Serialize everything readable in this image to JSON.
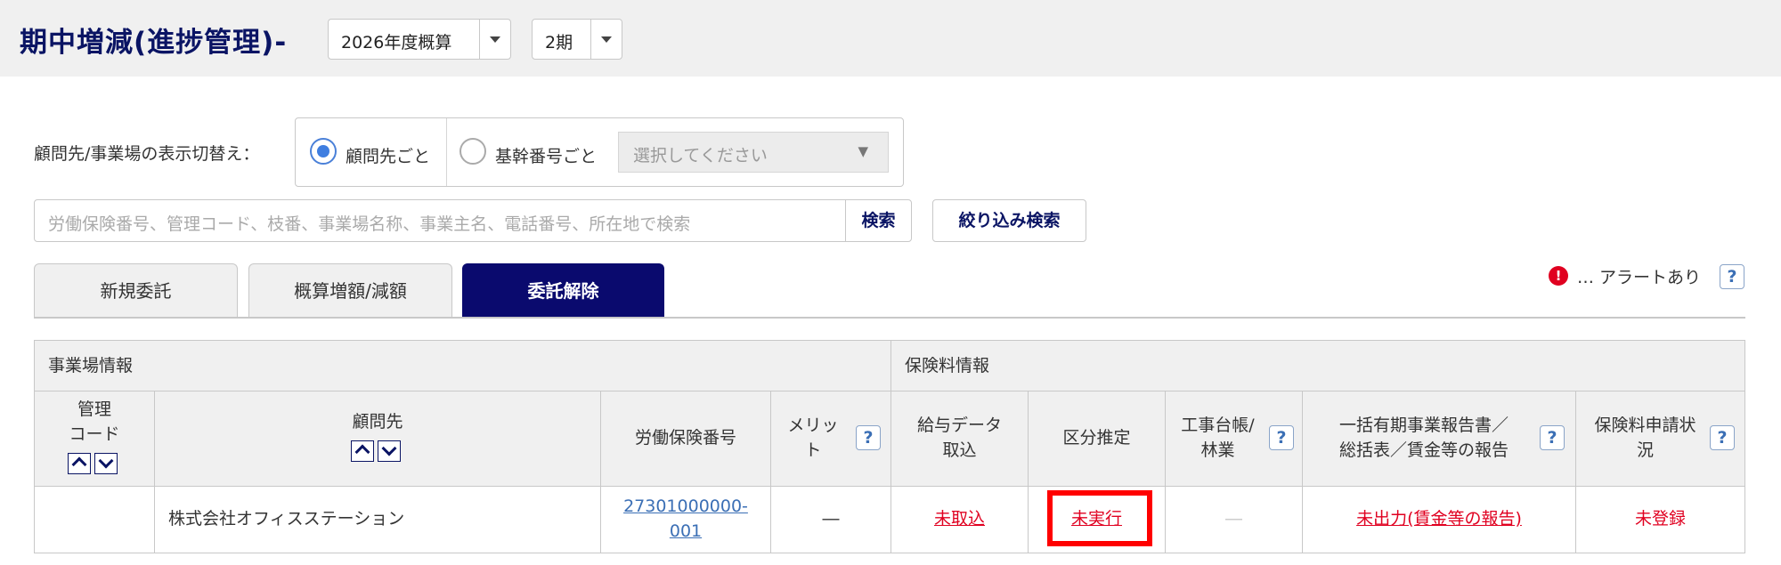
{
  "header": {
    "title": "期中増減(進捗管理)-",
    "fiscal_year_select": "2026年度概算",
    "period_select": "2期"
  },
  "filters": {
    "display_toggle_label": "顧問先/事業場の表示切替え：",
    "radio_client": "顧問先ごと",
    "radio_base_number": "基幹番号ごと",
    "radio_selected": "顧問先ごと",
    "base_number_dropdown_placeholder": "選択してください",
    "search_placeholder": "労働保険番号、管理コード、枝番、事業場名称、事業主名、電話番号、所在地で検索",
    "search_button": "検索",
    "filter_search_button": "絞り込み検索"
  },
  "tabs": [
    {
      "label": "新規委託",
      "active": false
    },
    {
      "label": "概算増額/減額",
      "active": false
    },
    {
      "label": "委託解除",
      "active": true
    }
  ],
  "legend": {
    "alert_icon": "!",
    "alert_text": "… アラートあり",
    "help_mark": "?"
  },
  "table": {
    "group_headers": {
      "workplace_info": "事業場情報",
      "premium_info": "保険料情報"
    },
    "columns": {
      "management_code": [
        "管理",
        "コード"
      ],
      "client": "顧問先",
      "labor_insurance_number": "労働保険番号",
      "merit": [
        "メリッ",
        "ト"
      ],
      "salary_data": [
        "給与データ",
        "取込"
      ],
      "classification": "区分推定",
      "construction_ledger": [
        "工事台帳/",
        "林業"
      ],
      "lump_sum_report": [
        "一括有期事業報告書／",
        "総括表／賃金等の報告"
      ],
      "premium_status": [
        "保険料申請状",
        "況"
      ]
    },
    "rows": [
      {
        "management_code": "",
        "client": "株式会社オフィスステーション",
        "labor_insurance_number": [
          "27301000000-",
          "001"
        ],
        "merit": "―",
        "salary_data": "未取込",
        "classification": "未実行",
        "construction_ledger": "―",
        "lump_sum_report": "未出力(賃金等の報告)",
        "premium_status": "未登録"
      }
    ]
  },
  "colors": {
    "title_navy": "#0a1464",
    "active_tab": "#0a0a6e",
    "alert_red": "#e00020",
    "link_blue": "#3b6fb5",
    "highlight_box": "#ff0000"
  }
}
